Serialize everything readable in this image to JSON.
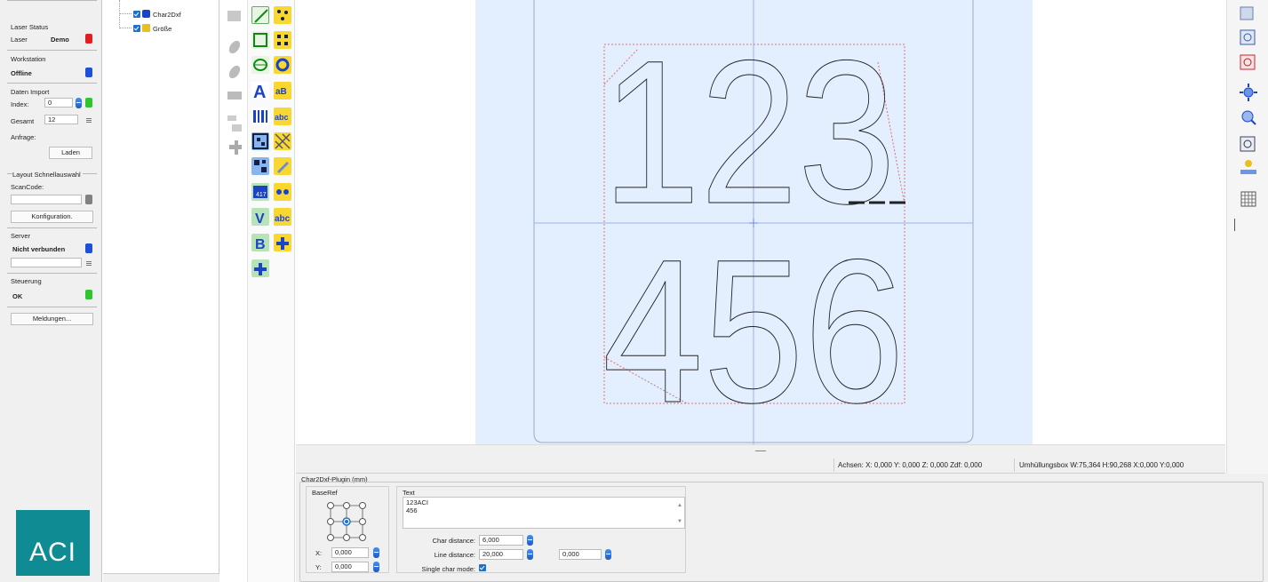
{
  "left_panel": {
    "laser_status": {
      "title": "Laser Status",
      "label": "Laser",
      "value": "Demo",
      "led_color": "#e02020"
    },
    "workstation": {
      "title": "Workstation",
      "value": "Offline",
      "led_color": "#1f4fd6"
    },
    "daten_import": {
      "title": "Daten Import",
      "index_label": "Index:",
      "index_value": "0",
      "gesamt_label": "Gesamt",
      "gesamt_value": "12",
      "anfrage_label": "Anfrage:",
      "laden_button": "Laden",
      "led_color": "#31c431"
    },
    "layout": {
      "title": "Layout Schnellauswahl",
      "scancode_label": "ScanCode:",
      "scancode_value": "",
      "konfig_button": "Konfiguration.",
      "led_color": "#808080"
    },
    "server": {
      "title": "Server",
      "value": "Nicht verbunden",
      "led_color": "#1f4fd6"
    },
    "steuerung": {
      "title": "Steuerung",
      "value": "OK",
      "led_color": "#31c431"
    },
    "meldungen_button": "Meldungen...",
    "logo_text": "ACI"
  },
  "tree": {
    "items": [
      {
        "label": "Char2Dxf",
        "icon": "puzzle-icon"
      },
      {
        "label": "Größe",
        "icon": "grid-icon"
      }
    ]
  },
  "canvas": {
    "line1": "123",
    "line2": "456"
  },
  "status_bar": {
    "achsen": "Achsen: X: 0,000  Y: 0,000  Z: 0,000  Zdf: 0,000",
    "huell": "Umhüllungsbox   W:75,364  H:90,268  X:0,000  Y:0,000"
  },
  "plugin": {
    "title": "Char2Dxf-Plugin (mm)",
    "baseref_label": "BaseRef",
    "x_label": "X:",
    "x_value": "0,000",
    "y_label": "Y:",
    "y_value": "0,000",
    "text_label": "Text",
    "text_line1": "123ACI",
    "text_line2": "456",
    "char_distance_label": "Char distance:",
    "char_distance_value": "6,000",
    "line_distance_label": "Line distance:",
    "line_distance_value": "20,000",
    "extra_value": "0,000",
    "single_char_label": "Single char mode:"
  },
  "colors": {
    "accent": "#1e72c8",
    "logo": "#0f8c93",
    "canvas_bg": "#e3efff"
  }
}
